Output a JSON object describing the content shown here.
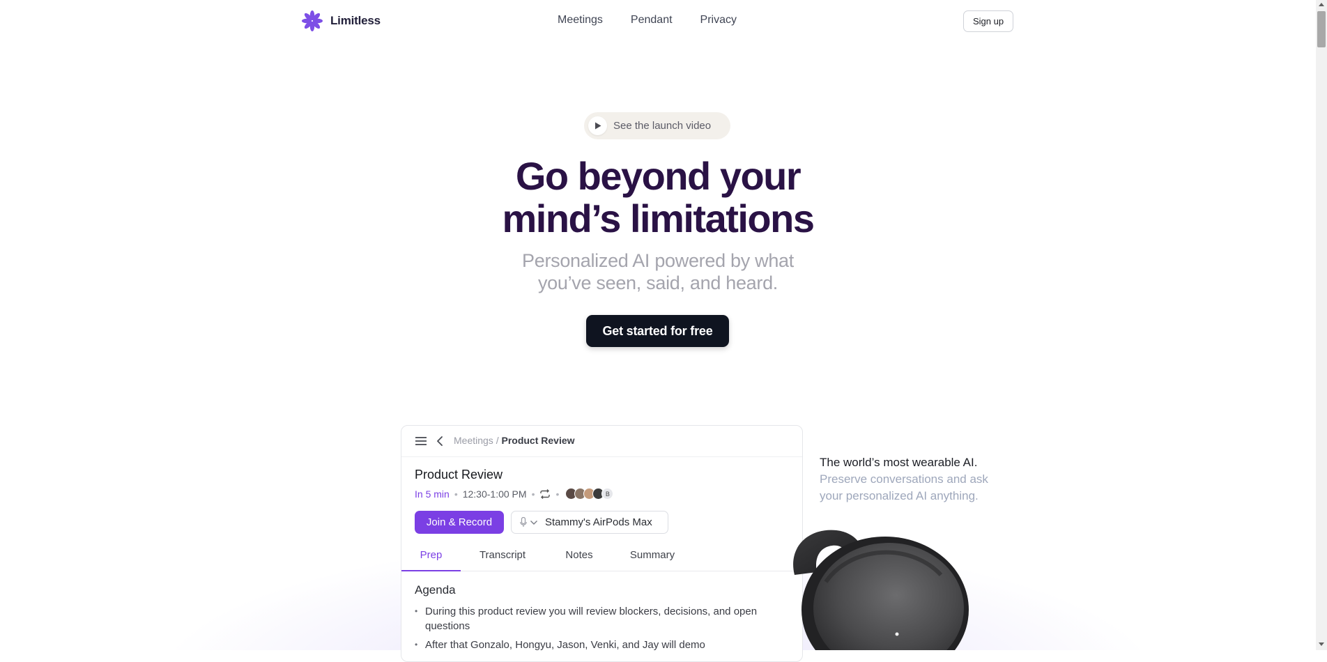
{
  "header": {
    "logo_text": "Limitless",
    "nav": [
      "Meetings",
      "Pendant",
      "Privacy"
    ],
    "signup_label": "Sign up"
  },
  "hero": {
    "video_label": "See the launch video",
    "title_line1": "Go beyond your",
    "title_line2": "mind’s limitations",
    "sub_line1": "Personalized AI powered by what",
    "sub_line2": "you’ve seen, said, and heard.",
    "cta_label": "Get started for free"
  },
  "app": {
    "breadcrumb_parent": "Meetings",
    "breadcrumb_sep": " / ",
    "breadcrumb_current": "Product Review",
    "title": "Product Review",
    "soon": "In 5 min",
    "time": "12:30-1:00 PM",
    "avatar_extra": "B",
    "join_label": "Join & Record",
    "device_name": "Stammy's AirPods Max",
    "tabs": [
      "Prep",
      "Transcript",
      "Notes",
      "Summary"
    ],
    "agenda_title": "Agenda",
    "agenda_items": [
      "During this product review you will review blockers, decisions, and open questions",
      "After that Gonzalo, Hongyu, Jason, Venki, and Jay will demo"
    ]
  },
  "side": {
    "headline": "The world’s most wearable AI.",
    "body": "Preserve conversations and ask your personalized AI anything."
  },
  "colors": {
    "accent": "#7b3fe4",
    "title": "#2a1245",
    "cta_bg": "#0f1420"
  }
}
